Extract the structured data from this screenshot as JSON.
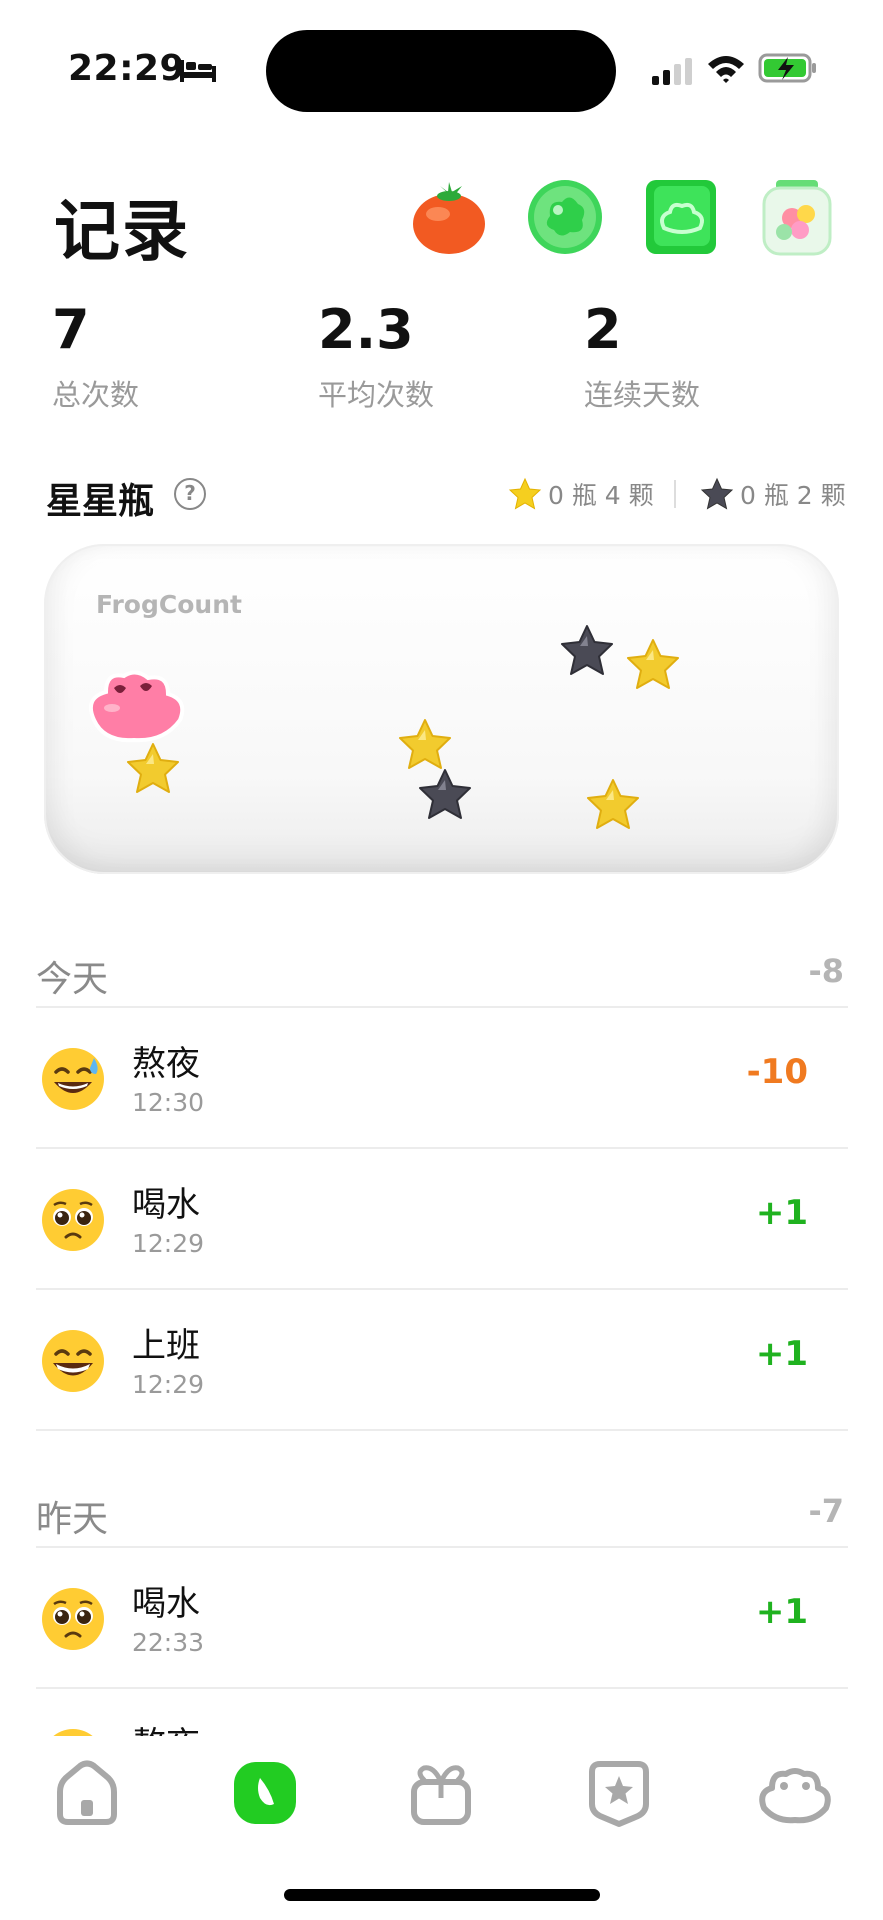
{
  "status_bar": {
    "time": "22:29",
    "icons": [
      "bed-icon",
      "signal-icon",
      "wifi-icon",
      "battery-charging-icon"
    ]
  },
  "header": {
    "title": "记录",
    "icons": [
      "tomato-icon",
      "green-blob-icon",
      "green-frog-card-icon",
      "candy-jar-icon"
    ]
  },
  "stats": [
    {
      "value": "7",
      "label": "总次数"
    },
    {
      "value": "2.3",
      "label": "平均次数"
    },
    {
      "value": "2",
      "label": "连续天数"
    }
  ],
  "star_jar": {
    "title": "星星瓶",
    "gold_count": "0 瓶 4 颗",
    "dark_count": "0 瓶 2 颗",
    "brand": "FrogCount",
    "stars": [
      "gold",
      "gold",
      "gold",
      "gold",
      "dark",
      "dark"
    ]
  },
  "sections": [
    {
      "label": "今天",
      "total": "-8",
      "rows": [
        {
          "title": "熬夜",
          "time": "12:30",
          "value": "-10",
          "emoji": "sweat-smile-emoji"
        },
        {
          "title": "喝水",
          "time": "12:29",
          "value": "+1",
          "emoji": "pleading-emoji"
        },
        {
          "title": "上班",
          "time": "12:29",
          "value": "+1",
          "emoji": "grin-emoji"
        }
      ]
    },
    {
      "label": "昨天",
      "total": "-7",
      "rows": [
        {
          "title": "喝水",
          "time": "22:33",
          "value": "+1",
          "emoji": "pleading-emoji"
        },
        {
          "title": "熬夜",
          "time": "",
          "value": "",
          "emoji": "sweat-smile-emoji"
        }
      ]
    }
  ],
  "tab_bar": {
    "items": [
      "home-icon",
      "record-icon",
      "gift-icon",
      "star-badge-icon",
      "frog-icon"
    ],
    "active": "record-icon",
    "accent": "#22cc22"
  }
}
